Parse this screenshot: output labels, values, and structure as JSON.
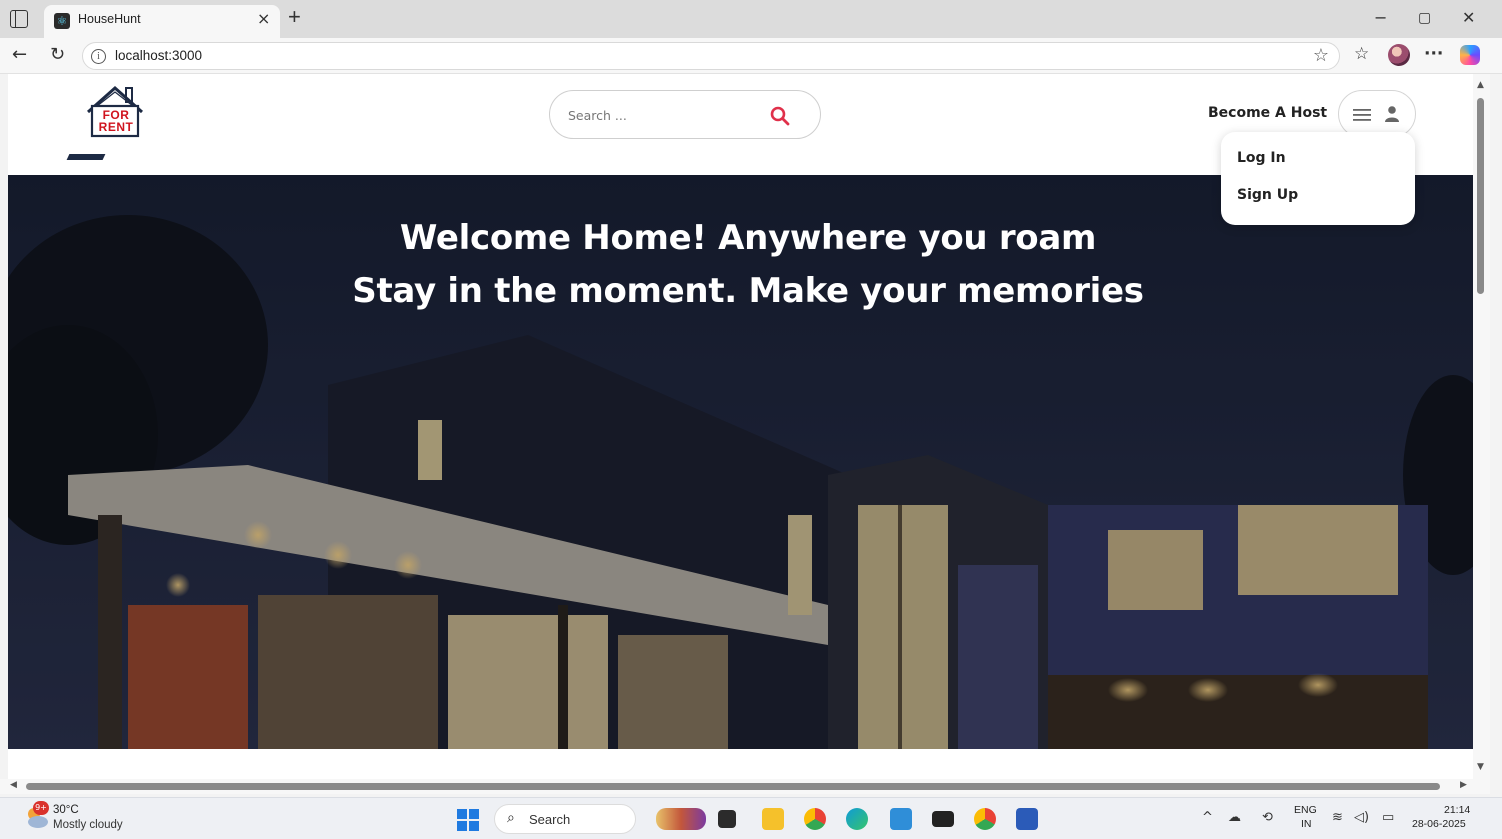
{
  "browser": {
    "tab_title": "HouseHunt",
    "url": "localhost:3000"
  },
  "site": {
    "logo_text_line1": "FOR",
    "logo_text_line2": "RENT",
    "search_placeholder": "Search ...",
    "become_host": "Become A Host",
    "menu": {
      "login": "Log In",
      "signup": "Sign Up"
    },
    "hero_line1": "Welcome Home! Anywhere you roam",
    "hero_line2": "Stay in the moment. Make your memories"
  },
  "taskbar": {
    "weather_badge": "9+",
    "weather_temp": "30°C",
    "weather_desc": "Mostly cloudy",
    "search_label": "Search",
    "lang_top": "ENG",
    "lang_bottom": "IN",
    "time": "21:14",
    "date": "28-06-2025"
  },
  "colors": {
    "search_accent": "#e0304a",
    "brand_red": "#d0141e",
    "hero_dark": "#1b2236"
  }
}
